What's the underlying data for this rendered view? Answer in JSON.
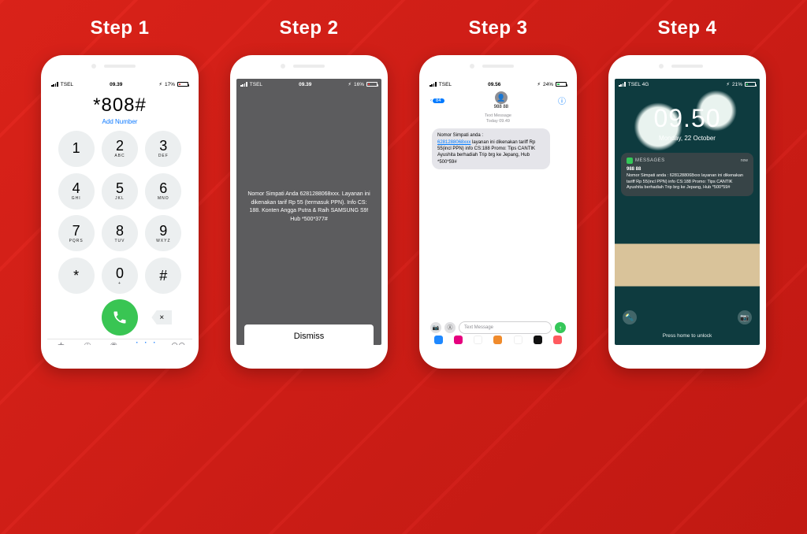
{
  "steps": {
    "s1_label": "Step 1",
    "s2_label": "Step 2",
    "s3_label": "Step 3",
    "s4_label": "Step 4"
  },
  "statusbar": {
    "carrier": "TSEL",
    "carrier_4g": "TSEL  4G",
    "time1": "09.39",
    "time2": "09.39",
    "time3": "09.56",
    "time4": "09.50",
    "batt1": "17%",
    "batt2": "16%",
    "batt3": "24%",
    "batt4": "21%",
    "lightning": "⚡︎"
  },
  "dialer": {
    "entered": "*808#",
    "add_number": "Add Number",
    "keys": [
      {
        "d": "1",
        "s": ""
      },
      {
        "d": "2",
        "s": "ABC"
      },
      {
        "d": "3",
        "s": "DEF"
      },
      {
        "d": "4",
        "s": "GHI"
      },
      {
        "d": "5",
        "s": "JKL"
      },
      {
        "d": "6",
        "s": "MNO"
      },
      {
        "d": "7",
        "s": "PQRS"
      },
      {
        "d": "8",
        "s": "TUV"
      },
      {
        "d": "9",
        "s": "WXYZ"
      },
      {
        "d": "*",
        "s": ""
      },
      {
        "d": "0",
        "s": "+"
      },
      {
        "d": "#",
        "s": ""
      }
    ],
    "tabs": {
      "favorites": "Favorites",
      "recents": "Recents",
      "contacts": "Contacts",
      "keypad": "Keypad",
      "voicemail": "Voicemail"
    },
    "delete_glyph": "×"
  },
  "ussd": {
    "message": "Nomor Simpati Anda 6281288068xxx. Layanan ini dikenakan tarif Rp 55 (termasuk PPN). Info CS: 188. Konten Angga Putra & Raih SAMSUNG S9! Hub *500*377#",
    "dismiss": "Dismiss"
  },
  "messages": {
    "back_count": "84",
    "contact_name": "988 88",
    "sub1": "Text Message",
    "sub2": "Today 09.49",
    "bubble_pre": "Nomor Simpati anda :",
    "bubble_link": "6281288068xxx",
    "bubble_post": " layanan ini dikenakan tariff Rp 55(incl PPN) info CS:188 Promo: Tips CANTIK Ayushita berhadiah Trip brg ke Jepang, Hub *500*59#",
    "placeholder": "Text Message"
  },
  "lock": {
    "clock": "09.50",
    "date": "Monday, 22 October",
    "notif_app": "MESSAGES",
    "notif_time": "now",
    "notif_title": "988 88",
    "notif_body": "Nomor Simpati anda : 6281288068xxx layanan ini dikenakan tariff Rp 55(incl PPN) info CS:188 Promo: Tips CANTIK Ayushita berhadiah Trip brg ke Jepang, Hub *500*59#",
    "press_home": "Press home to unlock"
  }
}
